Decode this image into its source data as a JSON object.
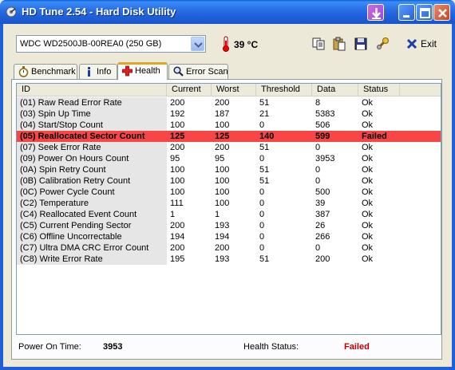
{
  "window": {
    "title": "HD Tune 2.54 - Hard Disk Utility"
  },
  "toolbar": {
    "drive": "WDC WD2500JB-00REA0 (250 GB)",
    "temperature": "39 °C",
    "exit_label": "Exit"
  },
  "tabs": [
    {
      "label": "Benchmark",
      "icon": "stopwatch-icon"
    },
    {
      "label": "Info",
      "icon": "info-icon"
    },
    {
      "label": "Health",
      "icon": "health-cross-icon",
      "active": true
    },
    {
      "label": "Error Scan",
      "icon": "magnifier-icon"
    }
  ],
  "table": {
    "columns": [
      "ID",
      "Current",
      "Worst",
      "Threshold",
      "Data",
      "Status"
    ],
    "rows": [
      [
        "(01) Raw Read Error Rate",
        "200",
        "200",
        "51",
        "8",
        "Ok"
      ],
      [
        "(03) Spin Up Time",
        "192",
        "187",
        "21",
        "5383",
        "Ok"
      ],
      [
        "(04) Start/Stop Count",
        "100",
        "100",
        "0",
        "506",
        "Ok"
      ],
      [
        "(05) Reallocated Sector Count",
        "125",
        "125",
        "140",
        "599",
        "Failed"
      ],
      [
        "(07) Seek Error Rate",
        "200",
        "200",
        "51",
        "0",
        "Ok"
      ],
      [
        "(09) Power On Hours Count",
        "95",
        "95",
        "0",
        "3953",
        "Ok"
      ],
      [
        "(0A) Spin Retry Count",
        "100",
        "100",
        "51",
        "0",
        "Ok"
      ],
      [
        "(0B) Calibration Retry Count",
        "100",
        "100",
        "51",
        "0",
        "Ok"
      ],
      [
        "(0C) Power Cycle Count",
        "100",
        "100",
        "0",
        "500",
        "Ok"
      ],
      [
        "(C2) Temperature",
        "111",
        "100",
        "0",
        "39",
        "Ok"
      ],
      [
        "(C4) Reallocated Event Count",
        "1",
        "1",
        "0",
        "387",
        "Ok"
      ],
      [
        "(C5) Current Pending Sector",
        "200",
        "193",
        "0",
        "26",
        "Ok"
      ],
      [
        "(C6) Offline Uncorrectable",
        "194",
        "194",
        "0",
        "266",
        "Ok"
      ],
      [
        "(C7) Ultra DMA CRC Error Count",
        "200",
        "200",
        "0",
        "0",
        "Ok"
      ],
      [
        "(C8) Write Error Rate",
        "195",
        "193",
        "51",
        "200",
        "Ok"
      ]
    ]
  },
  "status": {
    "power_on_label": "Power On Time:",
    "power_on_value": "3953",
    "health_label": "Health Status:",
    "health_value": "Failed"
  },
  "colors": {
    "failed_row": "#f64646",
    "failed_text": "#c00000",
    "title_bar": "#1f5fd8"
  }
}
